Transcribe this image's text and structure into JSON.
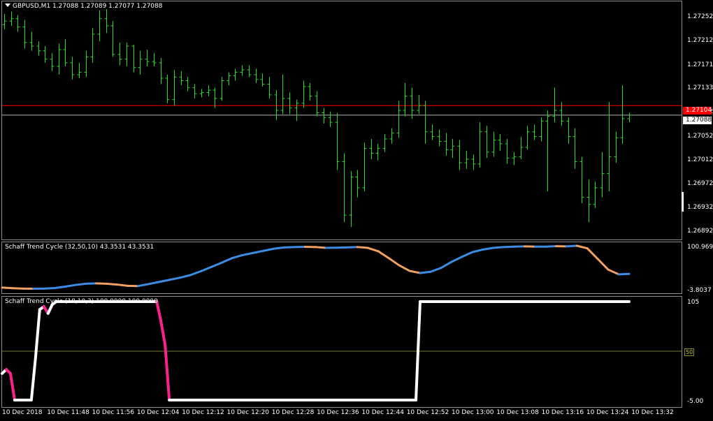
{
  "main": {
    "title": "GBPUSD,M1  1.27088 1.27089 1.27077 1.27088",
    "y_ticks": [
      "1.27252",
      "1.27212",
      "1.27171",
      "1.27133",
      "1.27092",
      "1.27052",
      "1.27012",
      "1.26972",
      "1.26932",
      "1.26892"
    ],
    "current_price": "1.27088",
    "red_line_price": "1.27104",
    "colors": {
      "candles": "#22dd22",
      "red_line": "#ff0000",
      "current_line": "#b4b4b4",
      "price_box": "#ff0000"
    }
  },
  "stc1": {
    "title": "Schaff Trend Cycle (32,50,10) 43.3531 43.3531",
    "y_max_label": "100.9696",
    "y_min_label": "-3.8037",
    "colors": {
      "up": "#3c8ce6",
      "down": "#f0a060"
    }
  },
  "stc2": {
    "title": "Schaff Trend Cycle (10,10,3) 100.0000 100.0000",
    "y_max_label": "105",
    "y_mid_label": "50",
    "y_min_label": "-5.00",
    "colors": {
      "up": "#ffffff",
      "down": "#ff1f8c",
      "level": "#7a7a32"
    }
  },
  "x_axis": [
    "10 Dec 2018",
    "10 Dec 11:48",
    "10 Dec 11:56",
    "10 Dec 12:04",
    "10 Dec 12:12",
    "10 Dec 12:20",
    "10 Dec 12:28",
    "10 Dec 12:36",
    "10 Dec 12:44",
    "10 Dec 12:52",
    "10 Dec 13:00",
    "10 Dec 13:08",
    "10 Dec 13:16",
    "10 Dec 13:24",
    "10 Dec 13:32"
  ],
  "chart_data": [
    {
      "type": "ohlc",
      "title": "GBPUSD,M1",
      "series": [
        {
          "name": "GBPUSD",
          "bars": [
            [
              1.2724,
              1.27258,
              1.27232,
              1.27246
            ],
            [
              1.27246,
              1.27262,
              1.27238,
              1.2725
            ],
            [
              1.2725,
              1.27256,
              1.27228,
              1.27236
            ],
            [
              1.27236,
              1.27248,
              1.272,
              1.2721
            ],
            [
              1.2721,
              1.27228,
              1.27196,
              1.27204
            ],
            [
              1.27204,
              1.27212,
              1.27188,
              1.27196
            ],
            [
              1.27196,
              1.27204,
              1.27176,
              1.27182
            ],
            [
              1.27182,
              1.27192,
              1.27162,
              1.2717
            ],
            [
              1.2717,
              1.27208,
              1.27156,
              1.27198
            ],
            [
              1.27198,
              1.27216,
              1.2717,
              1.27176
            ],
            [
              1.27176,
              1.27186,
              1.27148,
              1.27156
            ],
            [
              1.27156,
              1.27176,
              1.2715,
              1.2716
            ],
            [
              1.2716,
              1.27196,
              1.27152,
              1.27186
            ],
            [
              1.27186,
              1.27234,
              1.27176,
              1.27224
            ],
            [
              1.27224,
              1.27264,
              1.27212,
              1.2725
            ],
            [
              1.2725,
              1.27266,
              1.27226,
              1.27238
            ],
            [
              1.27238,
              1.27246,
              1.27186,
              1.2719
            ],
            [
              1.2719,
              1.2721,
              1.27172,
              1.27182
            ],
            [
              1.27182,
              1.2721,
              1.2717,
              1.27204
            ],
            [
              1.27204,
              1.27206,
              1.2716,
              1.27168
            ],
            [
              1.27168,
              1.27196,
              1.27156,
              1.27182
            ],
            [
              1.27182,
              1.27198,
              1.2717,
              1.27178
            ],
            [
              1.27178,
              1.27192,
              1.2717,
              1.27176
            ],
            [
              1.27176,
              1.27184,
              1.2714,
              1.2715
            ],
            [
              1.2715,
              1.27156,
              1.27108,
              1.27114
            ],
            [
              1.27114,
              1.27164,
              1.27104,
              1.27152
            ],
            [
              1.27152,
              1.27162,
              1.27138,
              1.27146
            ],
            [
              1.27146,
              1.27152,
              1.27128,
              1.27134
            ],
            [
              1.27134,
              1.2714,
              1.27116,
              1.27124
            ],
            [
              1.27124,
              1.27132,
              1.27118,
              1.27126
            ],
            [
              1.27126,
              1.27138,
              1.2712,
              1.2713
            ],
            [
              1.2713,
              1.27134,
              1.271,
              1.27116
            ],
            [
              1.27116,
              1.27152,
              1.27112,
              1.27146
            ],
            [
              1.27146,
              1.2716,
              1.27138,
              1.27154
            ],
            [
              1.27154,
              1.27166,
              1.27146,
              1.2716
            ],
            [
              1.2716,
              1.27172,
              1.27154,
              1.27164
            ],
            [
              1.27164,
              1.27172,
              1.27152,
              1.27156
            ],
            [
              1.27156,
              1.27166,
              1.27142,
              1.27148
            ],
            [
              1.27148,
              1.27158,
              1.27136,
              1.2714
            ],
            [
              1.2714,
              1.27152,
              1.27116,
              1.27122
            ],
            [
              1.27122,
              1.2713,
              1.2708,
              1.27096
            ],
            [
              1.27096,
              1.27156,
              1.2709,
              1.27116
            ],
            [
              1.27116,
              1.27126,
              1.2709,
              1.271
            ],
            [
              1.271,
              1.27114,
              1.27078,
              1.27108
            ],
            [
              1.27108,
              1.27146,
              1.271,
              1.27136
            ],
            [
              1.27136,
              1.27142,
              1.27112,
              1.2712
            ],
            [
              1.2712,
              1.27128,
              1.27086,
              1.27092
            ],
            [
              1.27092,
              1.271,
              1.27074,
              1.27084
            ],
            [
              1.27084,
              1.27094,
              1.27068,
              1.27076
            ],
            [
              1.27076,
              1.27092,
              1.26996,
              1.2701
            ],
            [
              1.2701,
              1.27024,
              1.26908,
              1.2692
            ],
            [
              1.2692,
              1.26994,
              1.269,
              1.26984
            ],
            [
              1.26984,
              1.26996,
              1.2695,
              1.26966
            ],
            [
              1.26966,
              1.27042,
              1.2696,
              1.27032
            ],
            [
              1.27032,
              1.27048,
              1.27014,
              1.27024
            ],
            [
              1.27024,
              1.2704,
              1.27012,
              1.27032
            ],
            [
              1.27032,
              1.27056,
              1.27026,
              1.27048
            ],
            [
              1.27048,
              1.27066,
              1.2704,
              1.27058
            ],
            [
              1.27058,
              1.27112,
              1.2705,
              1.27096
            ],
            [
              1.27096,
              1.27142,
              1.27086,
              1.2712
            ],
            [
              1.2712,
              1.27134,
              1.27082,
              1.27096
            ],
            [
              1.27096,
              1.27122,
              1.2709,
              1.27104
            ],
            [
              1.27104,
              1.27112,
              1.2704,
              1.2706
            ],
            [
              1.2706,
              1.27072,
              1.27046,
              1.27052
            ],
            [
              1.27052,
              1.27064,
              1.27036,
              1.27044
            ],
            [
              1.27044,
              1.27058,
              1.2702,
              1.2703
            ],
            [
              1.2703,
              1.27048,
              1.27016,
              1.27036
            ],
            [
              1.27036,
              1.27046,
              1.26996,
              1.27008
            ],
            [
              1.27008,
              1.27028,
              1.26998,
              1.27014
            ],
            [
              1.27014,
              1.27022,
              1.26996,
              1.27006
            ],
            [
              1.27006,
              1.27076,
              1.27,
              1.2706
            ],
            [
              1.2706,
              1.2707,
              1.27016,
              1.27026
            ],
            [
              1.27026,
              1.2706,
              1.27018,
              1.27046
            ],
            [
              1.27046,
              1.27056,
              1.27028,
              1.2704
            ],
            [
              1.2704,
              1.27048,
              1.27006,
              1.27016
            ],
            [
              1.27016,
              1.27026,
              1.27004,
              1.27018
            ],
            [
              1.27018,
              1.27052,
              1.27014,
              1.27034
            ],
            [
              1.27034,
              1.2707,
              1.2703,
              1.2706
            ],
            [
              1.2706,
              1.27072,
              1.27046,
              1.27052
            ],
            [
              1.27052,
              1.27084,
              1.27044,
              1.27078
            ],
            [
              1.27078,
              1.27096,
              1.2696,
              1.27086
            ],
            [
              1.27086,
              1.27134,
              1.27076,
              1.27096
            ],
            [
              1.27096,
              1.2711,
              1.2707,
              1.27078
            ],
            [
              1.27078,
              1.27084,
              1.2704,
              1.27052
            ],
            [
              1.27052,
              1.27066,
              1.26998,
              1.2701
            ],
            [
              1.2701,
              1.27018,
              1.2694,
              1.2695
            ],
            [
              1.2695,
              1.2698,
              1.26908,
              1.26938
            ],
            [
              1.26938,
              1.26976,
              1.26932,
              1.26966
            ],
            [
              1.26966,
              1.27026,
              1.2695,
              1.2699
            ],
            [
              1.2699,
              1.2711,
              1.2696,
              1.27018
            ],
            [
              1.27018,
              1.2706,
              1.27008,
              1.2705
            ],
            [
              1.2705,
              1.27138,
              1.2704,
              1.27082
            ],
            [
              1.27082,
              1.27092,
              1.27076,
              1.27088
            ]
          ]
        }
      ],
      "ylim": [
        1.26885,
        1.27272
      ]
    },
    {
      "type": "line",
      "title": "Schaff Trend Cycle (32,50,10)",
      "x": [
        0,
        5,
        10,
        15,
        20,
        25,
        30,
        35,
        40,
        45,
        50,
        55,
        60,
        65,
        70,
        75,
        80,
        85,
        90,
        95,
        100,
        105,
        110,
        115,
        120,
        125,
        130,
        135,
        140,
        145,
        150,
        155,
        160,
        165,
        170,
        175,
        180,
        185,
        190,
        195,
        200,
        205,
        210,
        215,
        220,
        225,
        230,
        235,
        240,
        245,
        250,
        255,
        260,
        265,
        270,
        275,
        280,
        285,
        290,
        295,
        300
      ],
      "values": [
        3,
        1.5,
        0.5,
        0.3,
        0.5,
        1.8,
        5,
        9,
        12,
        12.8,
        12,
        10,
        7,
        6.5,
        11,
        16,
        21,
        26,
        32,
        41,
        51,
        61,
        72,
        79,
        84,
        89,
        94,
        97,
        98,
        98.5,
        98,
        96,
        96.5,
        97,
        98,
        96,
        88,
        72,
        55,
        42,
        37,
        40,
        49,
        63,
        75,
        86,
        92,
        96,
        98,
        99,
        99.5,
        99,
        99,
        100,
        99.5,
        101,
        95,
        70,
        45,
        34,
        35
      ],
      "ylim": [
        -3.8037,
        100.9696
      ]
    },
    {
      "type": "line",
      "title": "Schaff Trend Cycle (10,10,3)",
      "x": [
        0,
        2,
        4,
        6,
        8,
        10,
        12,
        14,
        16,
        18,
        20,
        22,
        24,
        26,
        28,
        30,
        32,
        34,
        36,
        38,
        40,
        42,
        44,
        46,
        48,
        50,
        52,
        54,
        56,
        58,
        60,
        62,
        64,
        66,
        68,
        70,
        72,
        74,
        76,
        78,
        80,
        82,
        84,
        86,
        88,
        90,
        92,
        94,
        96,
        98,
        100,
        102,
        104,
        106,
        108,
        110,
        112,
        114,
        116,
        118,
        120,
        122,
        124,
        126,
        128,
        130,
        132,
        134,
        136,
        138,
        140,
        142,
        144,
        146,
        148,
        150,
        152,
        154,
        156,
        158,
        160,
        162,
        164,
        166,
        168,
        170,
        172,
        174,
        176,
        178,
        180,
        182,
        184,
        186,
        188,
        190,
        192,
        194,
        196,
        198,
        200,
        202,
        204,
        206,
        208,
        210,
        212,
        214,
        216,
        218,
        220,
        222,
        224,
        226,
        228,
        230,
        232,
        234,
        236,
        238,
        240,
        242,
        244,
        246,
        248,
        250,
        252,
        254,
        256,
        258,
        260,
        262,
        264,
        266,
        268,
        270,
        272,
        274,
        276,
        278,
        280,
        282,
        284,
        286,
        288,
        290,
        292,
        294,
        296,
        298,
        300
      ],
      "values": [
        27,
        31,
        27,
        0,
        0,
        0,
        0,
        0,
        43,
        92,
        95,
        88,
        97,
        100,
        100,
        100,
        100,
        100,
        100,
        100,
        100,
        100,
        100,
        100,
        100,
        100,
        100,
        100,
        100,
        100,
        100,
        100,
        100,
        100,
        100,
        100,
        100,
        100,
        80,
        56,
        0,
        0,
        0,
        0,
        0,
        0,
        0,
        0,
        0,
        0,
        0,
        0,
        0,
        0,
        0,
        0,
        0,
        0,
        0,
        0,
        0,
        0,
        0,
        0,
        0,
        0,
        0,
        0,
        0,
        0,
        0,
        0,
        0,
        0,
        0,
        0,
        0,
        0,
        0,
        0,
        0,
        0,
        0,
        0,
        0,
        0,
        0,
        0,
        0,
        0,
        0,
        0,
        0,
        0,
        0,
        0,
        0,
        0,
        0,
        0,
        100,
        100,
        100,
        100,
        100,
        100,
        100,
        100,
        100,
        100,
        100,
        100,
        100,
        100,
        100,
        100,
        100,
        100,
        100,
        100,
        100,
        100,
        100,
        100,
        100,
        100,
        100,
        100,
        100,
        100,
        100,
        100,
        100,
        100,
        100,
        100,
        100,
        100,
        100,
        100,
        100,
        100,
        100,
        100,
        100,
        100,
        100,
        100,
        100,
        100,
        100
      ],
      "ylim": [
        -5,
        105
      ]
    }
  ]
}
